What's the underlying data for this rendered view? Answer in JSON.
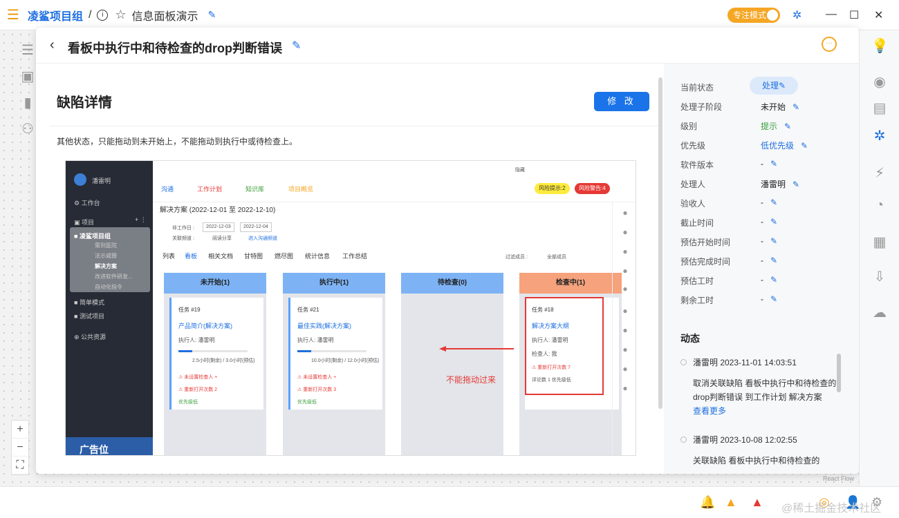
{
  "topbar": {
    "project": "凌鲨项目组",
    "sep": "/",
    "info": "i",
    "page": "信息面板演示",
    "focus": "专注模式"
  },
  "modal": {
    "title": "看板中执行中和待检查的drop判断错误",
    "section": "缺陷详情",
    "modify": "修 改",
    "desc": "其他状态，只能拖动到未开始上，不能拖动到执行中或待检查上。"
  },
  "props": [
    {
      "label": "当前状态",
      "value": "处理"
    },
    {
      "label": "处理子阶段",
      "value": "未开始"
    },
    {
      "label": "级别",
      "value": "提示"
    },
    {
      "label": "优先级",
      "value": "低优先级"
    },
    {
      "label": "软件版本",
      "value": "-"
    },
    {
      "label": "处理人",
      "value": "潘雷明"
    },
    {
      "label": "验收人",
      "value": "-"
    },
    {
      "label": "截止时间",
      "value": "-"
    },
    {
      "label": "预估开始时间",
      "value": "-"
    },
    {
      "label": "预估完成时间",
      "value": "-"
    },
    {
      "label": "预估工时",
      "value": "-"
    },
    {
      "label": "剩余工时",
      "value": "-"
    }
  ],
  "activity": {
    "title": "动态",
    "events": [
      {
        "head": "潘雷明 2023-11-01 14:03:51",
        "body": "取消关联缺陷 看板中执行中和待检查的drop判断错误 到工作计划 解决方案",
        "more": "查看更多"
      },
      {
        "head": "潘雷明 2023-10-08 12:02:55",
        "body": "关联缺陷 看板中执行中和待检查的"
      }
    ]
  },
  "shot": {
    "user": "潘雷明",
    "workbench": "工作台",
    "projects": "项目",
    "plus": "+ ⋮",
    "group": "凌鲨项目组",
    "groupitems": [
      "需到医院",
      "法示威摄",
      "解决方案",
      "改进软件研发...",
      "自动化指令"
    ],
    "simple": "简单模式",
    "test": "测试项目",
    "public": "公共资源",
    "ad": "广告位",
    "topright": "隐藏",
    "tabs": [
      "沟通",
      "工作计划",
      "知识库",
      "项目概览"
    ],
    "risk": "风险提示:2",
    "alarm": "风险警告:4",
    "crumb": "解决方案 (2022-12-01 至 2022-12-10)",
    "nonwork": "非工作日 :",
    "d1": "2022-12-03",
    "d2": "2022-12-04",
    "channel": "关联频道 :",
    "channelv": "阅读分享",
    "enter": "进入沟通频道",
    "vtabs": [
      "列表",
      "看板",
      "相关文档",
      "甘特图",
      "燃尽图",
      "统计信息",
      "工作总结"
    ],
    "filter": "过滤成员 :",
    "allmembers": "全部成员",
    "cols": [
      {
        "h": "未开始(1)",
        "color": "#7db3f5",
        "card": {
          "t": "任务 #19",
          "n": "产品简介(解决方案)",
          "a": "执行人:  潘雷明",
          "tm": "2.5小时(剩余) / 3.0小时(预估)",
          "w1": "⚠ 未设置检查人 +",
          "w2": "⚠ 重新打开次数 2",
          "pr": "优先级低"
        }
      },
      {
        "h": "执行中(1)",
        "color": "#7db3f5",
        "card": {
          "t": "任务 #21",
          "n": "最佳实践(解决方案)",
          "a": "执行人:  潘雷明",
          "tm": "10.0小时(剩余) / 12.0小时(预估)",
          "w1": "⚠ 未设置检查人 +",
          "w2": "⚠ 重新打开次数 3",
          "pr": "优先级低"
        }
      },
      {
        "h": "待检查(0)",
        "color": "#7db3f5"
      },
      {
        "h": "检查中(1)",
        "color": "#f5a27d",
        "card": {
          "t": "任务 #18",
          "n": "解决方案大纲",
          "a": "执行人:  潘雷明",
          "tm": "检查人:  我",
          "w1": "⚠ 重新打开次数 7",
          "w2": "评论数 1   优先级低",
          "pr": ""
        }
      }
    ],
    "note": "不能拖动过来"
  },
  "footer": {
    "reactflow": "React Flow",
    "watermark": "@稀土掘金技术社区"
  }
}
